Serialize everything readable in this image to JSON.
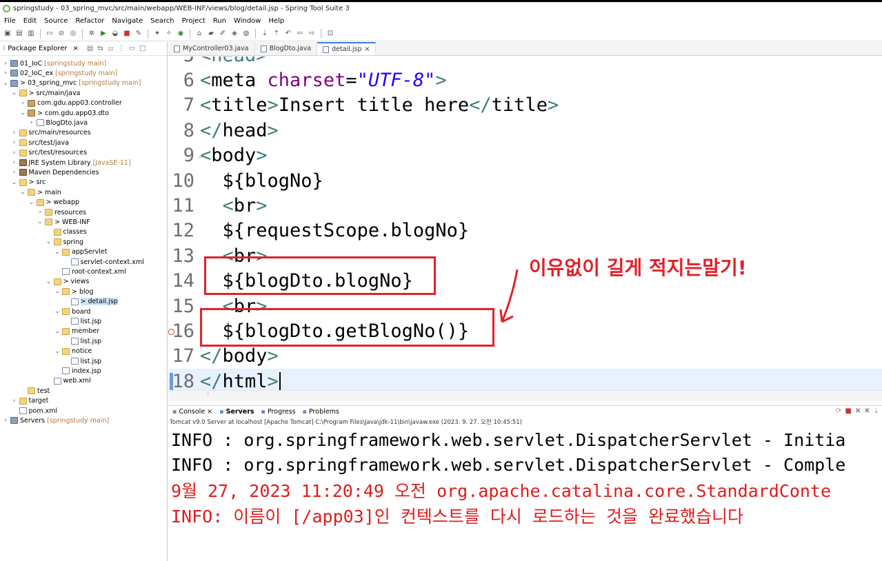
{
  "window": {
    "title": "springstudy - 03_spring_mvc/src/main/webapp/WEB-INF/views/blog/detail.jsp - Spring Tool Suite 3"
  },
  "menu": [
    "File",
    "Edit",
    "Source",
    "Refactor",
    "Navigate",
    "Search",
    "Project",
    "Run",
    "Window",
    "Help"
  ],
  "explorer": {
    "tab_label": "Package Explorer",
    "tree": [
      {
        "name": "01_IoC",
        "qual": "[springstudy main]",
        "icon": "project",
        "arrow": ">",
        "depth": 0
      },
      {
        "name": "02_IoC_ex",
        "qual": "[springstudy main]",
        "icon": "project",
        "arrow": ">",
        "depth": 0
      },
      {
        "name": "> 03_spring_mvc",
        "qual": "[springstudy main]",
        "icon": "project",
        "arrow": "v",
        "depth": 0
      },
      {
        "name": "> src/main/java",
        "qual": "",
        "icon": "folder",
        "arrow": "v",
        "depth": 1
      },
      {
        "name": "com.gdu.app03.controller",
        "qual": "",
        "icon": "pkg",
        "arrow": ">",
        "depth": 2
      },
      {
        "name": "> com.gdu.app03.dto",
        "qual": "",
        "icon": "pkg",
        "arrow": "v",
        "depth": 2
      },
      {
        "name": "BlogDto.java",
        "qual": "",
        "icon": "file",
        "arrow": ">",
        "depth": 3
      },
      {
        "name": "src/main/resources",
        "qual": "",
        "icon": "folder",
        "arrow": ">",
        "depth": 1
      },
      {
        "name": "src/test/java",
        "qual": "",
        "icon": "folder",
        "arrow": ">",
        "depth": 1
      },
      {
        "name": "src/test/resources",
        "qual": "",
        "icon": "folder",
        "arrow": ">",
        "depth": 1
      },
      {
        "name": "JRE System Library",
        "qual": "[JavaSE-11]",
        "icon": "jar",
        "arrow": ">",
        "depth": 1
      },
      {
        "name": "Maven Dependencies",
        "qual": "",
        "icon": "jar",
        "arrow": ">",
        "depth": 1
      },
      {
        "name": "> src",
        "qual": "",
        "icon": "folder",
        "arrow": "v",
        "depth": 1
      },
      {
        "name": "> main",
        "qual": "",
        "icon": "folder",
        "arrow": "v",
        "depth": 2
      },
      {
        "name": "> webapp",
        "qual": "",
        "icon": "folder",
        "arrow": "v",
        "depth": 3
      },
      {
        "name": "resources",
        "qual": "",
        "icon": "folder",
        "arrow": ">",
        "depth": 4
      },
      {
        "name": "> WEB-INF",
        "qual": "",
        "icon": "folder",
        "arrow": "v",
        "depth": 4
      },
      {
        "name": "classes",
        "qual": "",
        "icon": "folder",
        "arrow": "",
        "depth": 5
      },
      {
        "name": "spring",
        "qual": "",
        "icon": "folder",
        "arrow": "v",
        "depth": 5
      },
      {
        "name": "appServlet",
        "qual": "",
        "icon": "folder",
        "arrow": "v",
        "depth": 6
      },
      {
        "name": "servlet-context.xml",
        "qual": "",
        "icon": "file",
        "arrow": "",
        "depth": 7
      },
      {
        "name": "root-context.xml",
        "qual": "",
        "icon": "file",
        "arrow": "",
        "depth": 6
      },
      {
        "name": "> views",
        "qual": "",
        "icon": "folder",
        "arrow": "v",
        "depth": 5
      },
      {
        "name": "> blog",
        "qual": "",
        "icon": "folder",
        "arrow": "v",
        "depth": 6
      },
      {
        "name": "> detail.jsp",
        "qual": "",
        "icon": "file",
        "arrow": "",
        "depth": 7,
        "selected": true
      },
      {
        "name": "board",
        "qual": "",
        "icon": "folder",
        "arrow": "v",
        "depth": 6
      },
      {
        "name": "list.jsp",
        "qual": "",
        "icon": "file",
        "arrow": "",
        "depth": 7
      },
      {
        "name": "member",
        "qual": "",
        "icon": "folder",
        "arrow": "v",
        "depth": 6
      },
      {
        "name": "list.jsp",
        "qual": "",
        "icon": "file",
        "arrow": "",
        "depth": 7
      },
      {
        "name": "notice",
        "qual": "",
        "icon": "folder",
        "arrow": "v",
        "depth": 6
      },
      {
        "name": "list.jsp",
        "qual": "",
        "icon": "file",
        "arrow": "",
        "depth": 7
      },
      {
        "name": "index.jsp",
        "qual": "",
        "icon": "file",
        "arrow": "",
        "depth": 6
      },
      {
        "name": "web.xml",
        "qual": "",
        "icon": "file",
        "arrow": "",
        "depth": 5
      },
      {
        "name": "test",
        "qual": "",
        "icon": "folder",
        "arrow": "",
        "depth": 2
      },
      {
        "name": "target",
        "qual": "",
        "icon": "folder",
        "arrow": ">",
        "depth": 1
      },
      {
        "name": "pom.xml",
        "qual": "",
        "icon": "file",
        "arrow": "",
        "depth": 1
      },
      {
        "name": "Servers",
        "qual": "[springstudy main]",
        "icon": "project",
        "arrow": ">",
        "depth": 0
      }
    ]
  },
  "editor": {
    "tabs": [
      {
        "label": "MyController03.java",
        "active": false
      },
      {
        "label": "BlogDto.java",
        "active": false
      },
      {
        "label": "detail.jsp",
        "active": true
      }
    ],
    "lines": [
      {
        "no": "5",
        "indent": "",
        "segments": [
          {
            "cls": "tag",
            "t": "<head>"
          }
        ]
      },
      {
        "no": "6",
        "indent": "",
        "segments": [
          {
            "cls": "tag",
            "t": "<"
          },
          {
            "cls": "el",
            "t": "meta "
          },
          {
            "cls": "attr",
            "t": "charset"
          },
          {
            "cls": "el",
            "t": "="
          },
          {
            "cls": "str",
            "t": "\"UTF-8\""
          },
          {
            "cls": "tag",
            "t": ">"
          }
        ]
      },
      {
        "no": "7",
        "indent": "",
        "segments": [
          {
            "cls": "tag",
            "t": "<"
          },
          {
            "cls": "el",
            "t": "title"
          },
          {
            "cls": "tag",
            "t": ">"
          },
          {
            "cls": "el",
            "t": "Insert title here"
          },
          {
            "cls": "tag",
            "t": "</"
          },
          {
            "cls": "el",
            "t": "title"
          },
          {
            "cls": "tag",
            "t": ">"
          }
        ]
      },
      {
        "no": "8",
        "indent": "",
        "segments": [
          {
            "cls": "tag",
            "t": "</"
          },
          {
            "cls": "el",
            "t": "head"
          },
          {
            "cls": "tag",
            "t": ">"
          }
        ]
      },
      {
        "no": "9",
        "indent": "",
        "fold": true,
        "segments": [
          {
            "cls": "tag",
            "t": "<"
          },
          {
            "cls": "el",
            "t": "body"
          },
          {
            "cls": "tag",
            "t": ">"
          }
        ]
      },
      {
        "no": "10",
        "indent": "  ",
        "segments": [
          {
            "cls": "el",
            "t": "${blogNo}"
          }
        ]
      },
      {
        "no": "11",
        "indent": "  ",
        "segments": [
          {
            "cls": "tag",
            "t": "<"
          },
          {
            "cls": "el",
            "t": "br"
          },
          {
            "cls": "tag",
            "t": ">"
          }
        ]
      },
      {
        "no": "12",
        "indent": "  ",
        "segments": [
          {
            "cls": "el",
            "t": "${requestScope.blogNo}"
          }
        ]
      },
      {
        "no": "13",
        "indent": "  ",
        "segments": [
          {
            "cls": "tag",
            "t": "<"
          },
          {
            "cls": "el",
            "t": "br"
          },
          {
            "cls": "tag",
            "t": ">"
          }
        ]
      },
      {
        "no": "14",
        "indent": "  ",
        "segments": [
          {
            "cls": "el",
            "t": "${blogDto.blogNo}"
          }
        ]
      },
      {
        "no": "15",
        "indent": "  ",
        "segments": [
          {
            "cls": "tag",
            "t": "<"
          },
          {
            "cls": "el",
            "t": "br"
          },
          {
            "cls": "tag",
            "t": ">"
          }
        ]
      },
      {
        "no": "16",
        "indent": "  ",
        "error": true,
        "segments": [
          {
            "cls": "el",
            "t": "${blogDto.getBlogNo()}"
          }
        ]
      },
      {
        "no": "17",
        "indent": "",
        "segments": [
          {
            "cls": "tag",
            "t": "</"
          },
          {
            "cls": "el",
            "t": "body"
          },
          {
            "cls": "tag",
            "t": ">"
          }
        ]
      },
      {
        "no": "18",
        "indent": "",
        "current": true,
        "segments": [
          {
            "cls": "tag",
            "t": "</"
          },
          {
            "cls": "el",
            "t": "html"
          },
          {
            "cls": "tag",
            "t": ">"
          }
        ]
      }
    ],
    "annotation": "이유없이 길게 적지는말기!"
  },
  "console": {
    "tabs": [
      {
        "label": "Console",
        "active": false
      },
      {
        "label": "Servers",
        "active": true
      },
      {
        "label": "Progress",
        "active": false
      },
      {
        "label": "Problems",
        "active": false
      }
    ],
    "header": "Tomcat v9.0 Server at localhost [Apache Tomcat] C:\\Program Files\\Java\\jdk-11\\bin\\javaw.exe  (2023. 9. 27. 오전 10:45:51)",
    "lines": [
      {
        "type": "info",
        "text": "INFO : org.springframework.web.servlet.DispatcherServlet - Initia"
      },
      {
        "type": "info",
        "text": "INFO : org.springframework.web.servlet.DispatcherServlet - Comple"
      },
      {
        "type": "err",
        "text": "9월 27, 2023 11:20:49 오전 org.apache.catalina.core.StandardConte"
      },
      {
        "type": "err",
        "text": "INFO: 이름이 [/app03]인 컨텍스트를 다시 로드하는 것을 완료했습니다"
      }
    ]
  }
}
